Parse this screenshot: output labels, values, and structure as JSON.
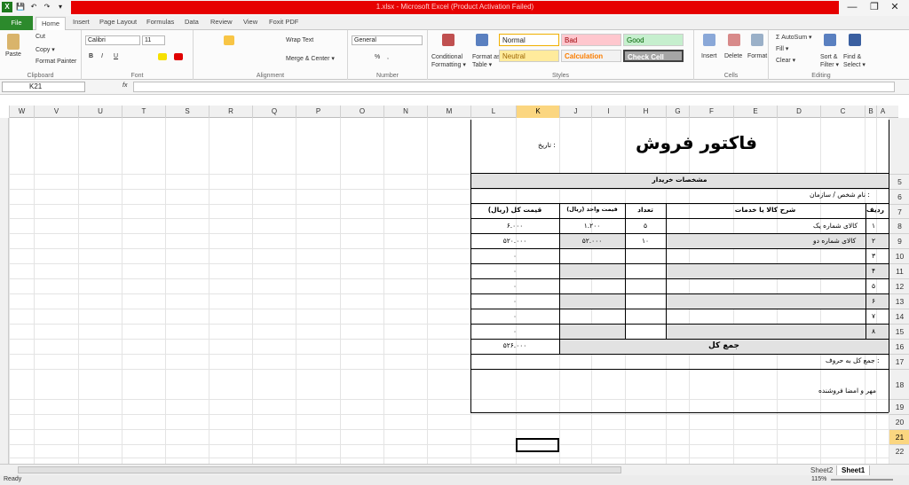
{
  "app": {
    "title": "1.xlsx - Microsoft Excel (Product Activation Failed)"
  },
  "qat": {
    "save": "💾",
    "undo": "↶",
    "redo": "↷",
    "more": "▾"
  },
  "window": {
    "minimize": "—",
    "restore": "❐",
    "close": "✕"
  },
  "tabs": [
    "File",
    "Home",
    "Insert",
    "Page Layout",
    "Formulas",
    "Data",
    "Review",
    "View",
    "Foxit PDF"
  ],
  "ribbon": {
    "clipboard": {
      "paste": "Paste",
      "cut": "Cut",
      "copy": "Copy ▾",
      "format_painter": "Format Painter",
      "label": "Clipboard"
    },
    "font": {
      "name": "Calibri",
      "size": "11",
      "label": "Font",
      "bold": "B",
      "italic": "I",
      "underline": "U"
    },
    "alignment": {
      "wrap": "Wrap Text",
      "merge": "Merge & Center ▾",
      "label": "Alignment"
    },
    "number": {
      "format": "General",
      "label": "Number",
      "percent": "%",
      "comma": ","
    },
    "styles": {
      "cond": "Conditional Formatting ▾",
      "table": "Format as Table ▾",
      "normal": "Normal",
      "bad": "Bad",
      "good": "Good",
      "neutral": "Neutral",
      "calculation": "Calculation",
      "check": "Check Cell",
      "label": "Styles"
    },
    "cells": {
      "insert": "Insert",
      "delete": "Delete",
      "format": "Format",
      "label": "Cells"
    },
    "editing": {
      "autosum": "Σ AutoSum ▾",
      "fill": "Fill ▾",
      "clear": "Clear ▾",
      "sort": "Sort & Filter ▾",
      "find": "Find & Select ▾",
      "label": "Editing"
    }
  },
  "namebox": "K21",
  "fx": "fx",
  "columns": [
    "W",
    "V",
    "U",
    "T",
    "S",
    "R",
    "Q",
    "P",
    "O",
    "N",
    "M",
    "L",
    "K",
    "J",
    "I",
    "H",
    "G",
    "F",
    "E",
    "D",
    "C",
    "B",
    "A"
  ],
  "rows": [
    "5",
    "6",
    "7",
    "8",
    "9",
    "10",
    "11",
    "12",
    "13",
    "14",
    "15",
    "16",
    "17",
    "18",
    "19",
    "20",
    "21",
    "22"
  ],
  "invoice": {
    "title": "فاكتور فروش",
    "date_label": "تاريخ :",
    "buyer_header": "مشخصات خريدار",
    "buyer_name": "نام شخص / سازمان :",
    "headers": {
      "row": "رديف",
      "desc": "شرح كالا يا خدمات",
      "qty": "تعداد",
      "unit": "قيمت واحد (ريال)",
      "total": "قيمت كل (ريال)"
    },
    "items": [
      {
        "row": "١",
        "desc": "كالای شماره يک",
        "qty": "۵",
        "unit": "۱.۲۰۰",
        "total": "۶.۰۰۰"
      },
      {
        "row": "۲",
        "desc": "كالای شماره دو",
        "qty": "۱۰",
        "unit": "۵۲.۰۰۰",
        "total": "۵۲۰.۰۰۰"
      },
      {
        "row": "۳",
        "desc": "",
        "qty": "",
        "unit": "",
        "total": "۰"
      },
      {
        "row": "۴",
        "desc": "",
        "qty": "",
        "unit": "",
        "total": "۰"
      },
      {
        "row": "۵",
        "desc": "",
        "qty": "",
        "unit": "",
        "total": "۰"
      },
      {
        "row": "۶",
        "desc": "",
        "qty": "",
        "unit": "",
        "total": "۰"
      },
      {
        "row": "۷",
        "desc": "",
        "qty": "",
        "unit": "",
        "total": "۰"
      },
      {
        "row": "۸",
        "desc": "",
        "qty": "",
        "unit": "",
        "total": "۰"
      }
    ],
    "sum_label": "جمع كل",
    "sum_value": "۵۲۶.۰۰۰",
    "sum_words": "جمع كل به حروف :",
    "signature": "مهر و امضا فروشنده"
  },
  "sheets": [
    "Sheet2",
    "Sheet1"
  ],
  "status": {
    "ready": "Ready",
    "zoom": "115%"
  }
}
